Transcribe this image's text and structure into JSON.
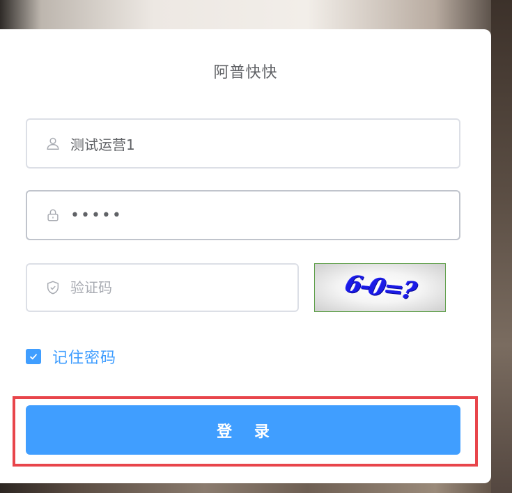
{
  "app": {
    "title": "阿普快快"
  },
  "form": {
    "username": {
      "value": "测试运营1",
      "icon": "user-icon"
    },
    "password": {
      "value": "•••••",
      "icon": "lock-icon"
    },
    "captcha": {
      "placeholder": "验证码",
      "icon": "shield-check-icon",
      "image_text": "6-0=?"
    },
    "remember": {
      "label": "记住密码",
      "checked": true
    },
    "login_label": "登 录"
  },
  "colors": {
    "primary": "#409eff",
    "highlight_outline": "#e8454b",
    "text": "#606266",
    "placeholder": "#a8abb2"
  }
}
